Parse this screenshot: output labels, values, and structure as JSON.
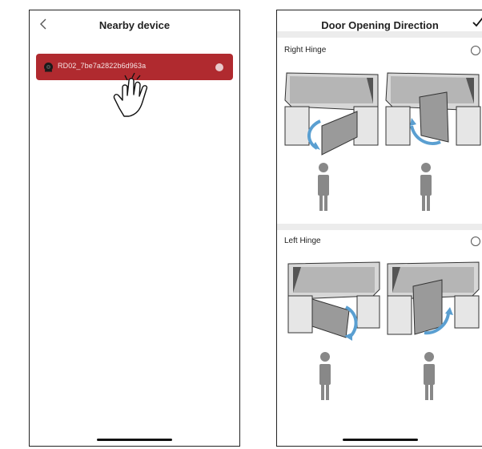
{
  "nearby": {
    "title": "Nearby device",
    "device_name": "RD02_7be7a2822b6d963a"
  },
  "direction": {
    "title": "Door Opening Direction",
    "options": [
      {
        "label": "Right Hinge"
      },
      {
        "label": "Left Hinge"
      }
    ]
  },
  "colors": {
    "accent": "#b02a2f",
    "arrow": "#5a9fd1",
    "separator": "#ececec"
  },
  "icons": {
    "back": "chevron-left-icon",
    "confirm": "checkmark-icon",
    "device": "camera-icon",
    "hand": "pointing-hand-icon"
  }
}
